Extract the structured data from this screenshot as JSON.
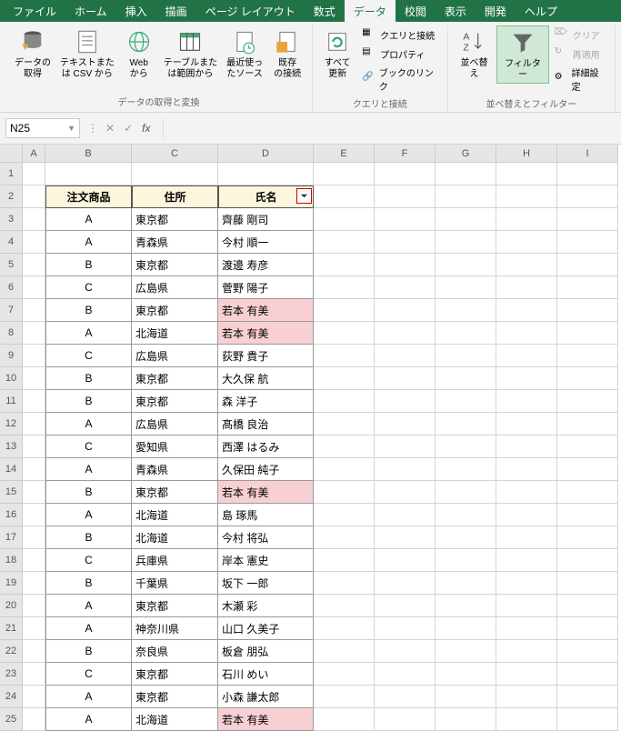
{
  "tabs": {
    "file": "ファイル",
    "home": "ホーム",
    "insert": "挿入",
    "draw": "描画",
    "pagelayout": "ページ レイアウト",
    "formulas": "数式",
    "data": "データ",
    "review": "校閲",
    "view": "表示",
    "developer": "開発",
    "help": "ヘルプ"
  },
  "ribbon": {
    "get_data": "データの\n取得",
    "from_csv": "テキストまた\nは CSV から",
    "from_web": "Web\nから",
    "from_table": "テーブルまた\nは範囲から",
    "recent": "最近使っ\nたソース",
    "existing": "既存\nの接続",
    "grp1": "データの取得と変換",
    "refresh": "すべて\n更新",
    "qc": "クエリと接続",
    "props": "プロパティ",
    "links": "ブックのリンク",
    "grp2": "クエリと接続",
    "sort": "並べ替え",
    "filter": "フィルター",
    "clear": "クリア",
    "reapply": "再適用",
    "advanced": "詳細設定",
    "grp3": "並べ替えとフィルター"
  },
  "namebox": "N25",
  "headers": [
    "",
    "A",
    "B",
    "C",
    "D",
    "E",
    "F",
    "G",
    "H",
    "I"
  ],
  "table_headers": {
    "B": "注文商品",
    "C": "住所",
    "D": "氏名"
  },
  "rows": [
    {
      "n": 3,
      "b": "A",
      "c": "東京都",
      "d": "齊藤 剛司"
    },
    {
      "n": 4,
      "b": "A",
      "c": "青森県",
      "d": "今村 順一"
    },
    {
      "n": 5,
      "b": "B",
      "c": "東京都",
      "d": "渡邊 寿彦"
    },
    {
      "n": 6,
      "b": "C",
      "c": "広島県",
      "d": "菅野 陽子"
    },
    {
      "n": 7,
      "b": "B",
      "c": "東京都",
      "d": "若本 有美",
      "hl": true
    },
    {
      "n": 8,
      "b": "A",
      "c": "北海道",
      "d": "若本 有美",
      "hl": true
    },
    {
      "n": 9,
      "b": "C",
      "c": "広島県",
      "d": "荻野 貴子"
    },
    {
      "n": 10,
      "b": "B",
      "c": "東京都",
      "d": "大久保 航"
    },
    {
      "n": 11,
      "b": "B",
      "c": "東京都",
      "d": "森 洋子"
    },
    {
      "n": 12,
      "b": "A",
      "c": "広島県",
      "d": "髙橋 良治"
    },
    {
      "n": 13,
      "b": "C",
      "c": "愛知県",
      "d": "西澤 はるみ"
    },
    {
      "n": 14,
      "b": "A",
      "c": "青森県",
      "d": "久保田 純子"
    },
    {
      "n": 15,
      "b": "B",
      "c": "東京都",
      "d": "若本 有美",
      "hl": true
    },
    {
      "n": 16,
      "b": "A",
      "c": "北海道",
      "d": "島 琢馬"
    },
    {
      "n": 17,
      "b": "B",
      "c": "北海道",
      "d": "今村 将弘"
    },
    {
      "n": 18,
      "b": "C",
      "c": "兵庫県",
      "d": "岸本 憲史"
    },
    {
      "n": 19,
      "b": "B",
      "c": "千葉県",
      "d": "坂下 一郎"
    },
    {
      "n": 20,
      "b": "A",
      "c": "東京都",
      "d": "木瀬 彩"
    },
    {
      "n": 21,
      "b": "A",
      "c": "神奈川県",
      "d": "山口 久美子"
    },
    {
      "n": 22,
      "b": "B",
      "c": "奈良県",
      "d": "板倉 朋弘"
    },
    {
      "n": 23,
      "b": "C",
      "c": "東京都",
      "d": "石川 めい"
    },
    {
      "n": 24,
      "b": "A",
      "c": "東京都",
      "d": "小森 謙太郎"
    },
    {
      "n": 25,
      "b": "A",
      "c": "北海道",
      "d": "若本 有美",
      "hl": true
    }
  ]
}
